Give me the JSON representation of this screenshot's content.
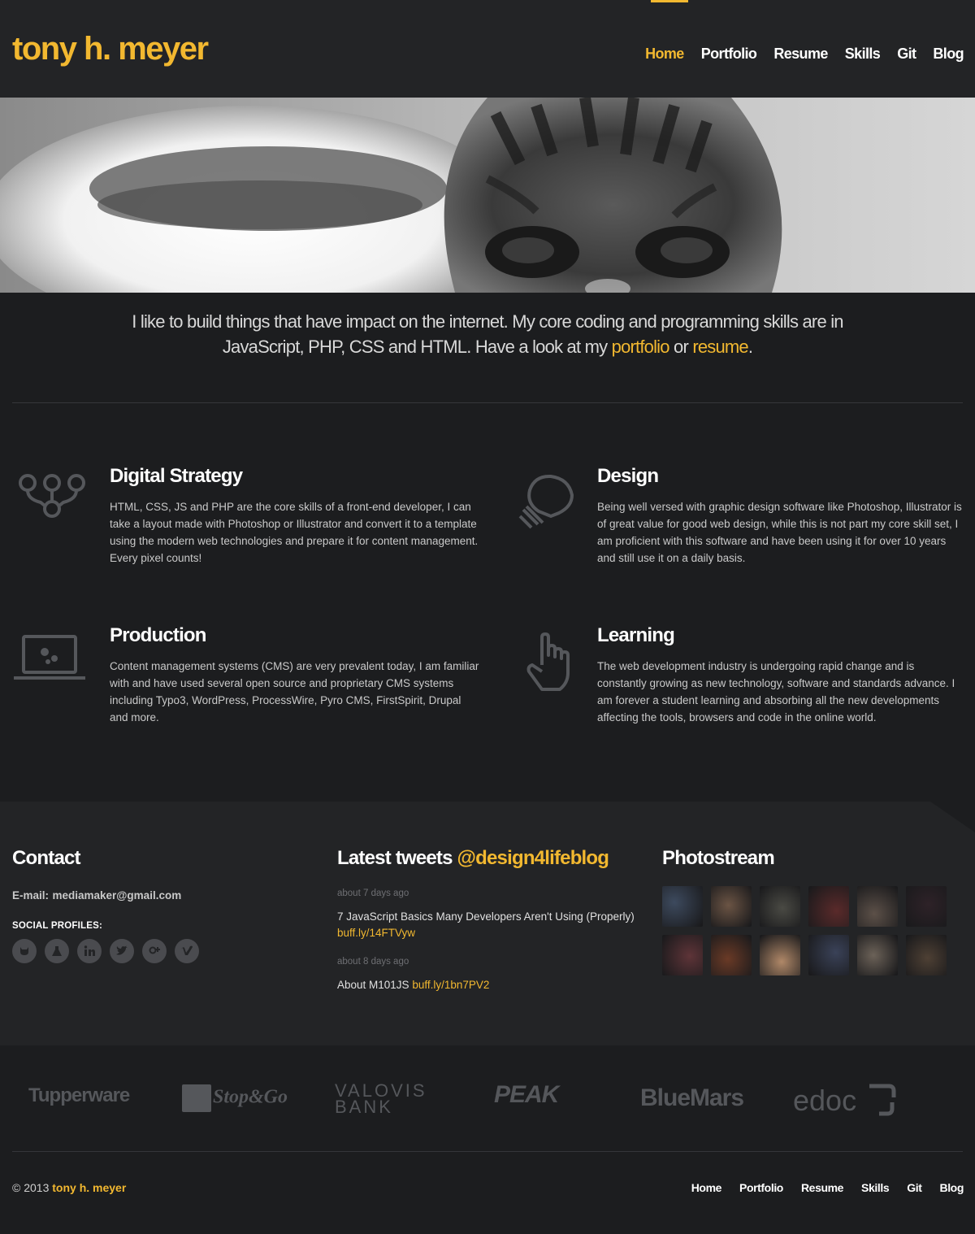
{
  "site": {
    "logo": "tony h. meyer"
  },
  "nav": [
    {
      "label": "Home",
      "active": true
    },
    {
      "label": "Portfolio"
    },
    {
      "label": "Resume"
    },
    {
      "label": "Skills"
    },
    {
      "label": "Git"
    },
    {
      "label": "Blog"
    }
  ],
  "intro": {
    "text_before": "I like to build things that have impact on the internet. My core coding and programming skills are in JavaScript, PHP, CSS and HTML. Have a look at my ",
    "link1": "portfolio",
    "between": " or ",
    "link2": "resume",
    "after": "."
  },
  "features": [
    {
      "icon": "network-icon",
      "title": "Digital Strategy",
      "text": "HTML, CSS, JS and PHP are the core skills of a front-end developer, I can take a layout made with Photoshop or Illustrator and convert it to a template using the modern web technologies and prepare it for content management. Every pixel counts!"
    },
    {
      "icon": "lightbulb-icon",
      "title": "Design",
      "text": "Being well versed with graphic design software like Photoshop, Illustrator is of great value for good web design, while this is not part my core skill set, I am proficient with this software and have been using it for over 10 years and still use it on a daily basis."
    },
    {
      "icon": "laptop-gears-icon",
      "title": "Production",
      "text": "Content management systems (CMS) are very prevalent today, I am familiar with and have used several open source and proprietary CMS systems including Typo3, WordPress, ProcessWire, Pyro CMS, FirstSpirit, Drupal and more."
    },
    {
      "icon": "pointing-hand-icon",
      "title": "Learning",
      "text": "The web development industry is undergoing rapid change and is constantly growing as new technology, software and standards advance. I am forever a student learning and absorbing all the new developments affecting the tools, browsers and code in the online world."
    }
  ],
  "contact": {
    "title": "Contact",
    "email_label": "E-mail:",
    "email": "mediamaker@gmail.com",
    "social_title": "SOCIAL PROFILES:",
    "social": [
      "github-icon",
      "flask-icon",
      "linkedin-icon",
      "twitter-icon",
      "google-plus-icon",
      "vimeo-icon"
    ]
  },
  "tweets": {
    "title": "Latest tweets",
    "handle": "@design4lifeblog",
    "items": [
      {
        "time": "about 7 days ago",
        "text": "7 JavaScript Basics Many Developers Aren't Using (Properly)",
        "link": "buff.ly/14FTVyw"
      },
      {
        "time": "about 8 days ago",
        "text": "About M101JS",
        "link": "buff.ly/1bn7PV2"
      }
    ]
  },
  "photostream": {
    "title": "Photostream",
    "colors": [
      "#3d4a5e",
      "#6b5444",
      "#4a4a44",
      "#5a2a2a",
      "#5c5048",
      "#2e2228",
      "#5e3438",
      "#6a3a26",
      "#b08868",
      "#3a4258",
      "#6c6258",
      "#4e4034"
    ]
  },
  "clients": [
    "Tupperware",
    "Stop&Go",
    "VALOVIS BANK",
    "PEAK",
    "BlueMars",
    "edoc"
  ],
  "footer": {
    "copyright": "© 2013",
    "brand": "tony h. meyer",
    "nav": [
      "Home",
      "Portfolio",
      "Resume",
      "Skills",
      "Git",
      "Blog"
    ]
  }
}
